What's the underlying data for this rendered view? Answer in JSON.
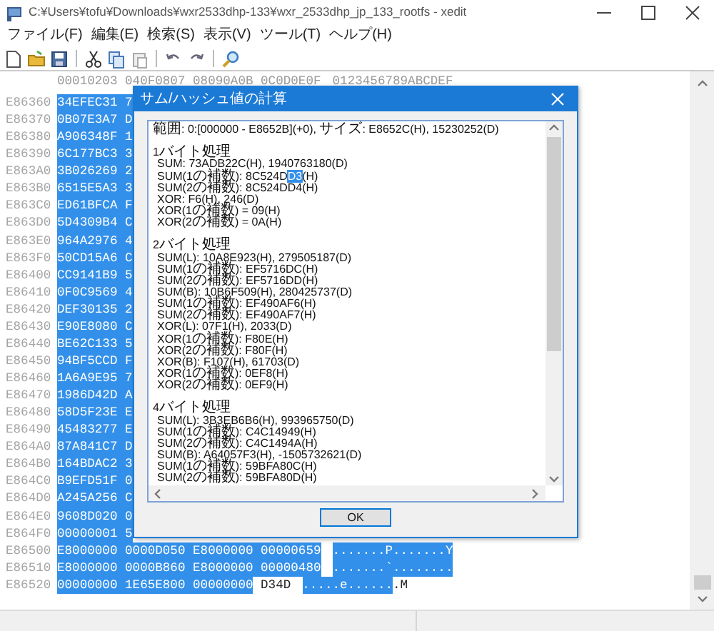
{
  "window": {
    "title": "C:¥Users¥tofu¥Downloads¥wxr2533dhp-133¥wxr_2533dhp_jp_133_rootfs - xedit"
  },
  "menu": [
    "ファイル(F)",
    "編集(E)",
    "検索(S)",
    "表示(V)",
    "ツール(T)",
    "ヘルプ(H)"
  ],
  "hex_view": {
    "header": {
      "hex": "00010203 040F0807 08090A0B 0C0D0E0F",
      "ascii": "0123456789ABCDEF"
    },
    "rows": [
      {
        "address": "E86360",
        "hex": [
          {
            "text": "34EFEC31 7",
            "selected": true
          }
        ]
      },
      {
        "address": "E86370",
        "hex": [
          {
            "text": "0B07E3A7 D",
            "selected": true
          }
        ]
      },
      {
        "address": "E86380",
        "hex": [
          {
            "text": "A906348F 1",
            "selected": true
          }
        ]
      },
      {
        "address": "E86390",
        "hex": [
          {
            "text": "6C177BC3 3",
            "selected": true
          }
        ]
      },
      {
        "address": "E863A0",
        "hex": [
          {
            "text": "3B026269 2",
            "selected": true
          }
        ]
      },
      {
        "address": "E863B0",
        "hex": [
          {
            "text": "6515E5A3 3",
            "selected": true
          }
        ]
      },
      {
        "address": "E863C0",
        "hex": [
          {
            "text": "ED61BFCA F",
            "selected": true
          }
        ]
      },
      {
        "address": "E863D0",
        "hex": [
          {
            "text": "5D4309B4 C",
            "selected": true
          }
        ]
      },
      {
        "address": "E863E0",
        "hex": [
          {
            "text": "964A2976 4",
            "selected": true
          }
        ]
      },
      {
        "address": "E863F0",
        "hex": [
          {
            "text": "50CD15A6 C",
            "selected": true
          }
        ]
      },
      {
        "address": "E86400",
        "hex": [
          {
            "text": "CC9141B9 5",
            "selected": true
          }
        ]
      },
      {
        "address": "E86410",
        "hex": [
          {
            "text": "0F0C9569 4",
            "selected": true
          }
        ]
      },
      {
        "address": "E86420",
        "hex": [
          {
            "text": "DEF30135 2",
            "selected": true
          }
        ]
      },
      {
        "address": "E86430",
        "hex": [
          {
            "text": "E90E8080 C",
            "selected": true
          }
        ]
      },
      {
        "address": "E86440",
        "hex": [
          {
            "text": "BE62C133 5",
            "selected": true
          }
        ]
      },
      {
        "address": "E86450",
        "hex": [
          {
            "text": "94BF5CCD F",
            "selected": true
          }
        ]
      },
      {
        "address": "E86460",
        "hex": [
          {
            "text": "1A6A9E95 7",
            "selected": true
          }
        ]
      },
      {
        "address": "E86470",
        "hex": [
          {
            "text": "1986D42D A",
            "selected": true
          }
        ]
      },
      {
        "address": "E86480",
        "hex": [
          {
            "text": "58D5F23E E",
            "selected": true
          }
        ]
      },
      {
        "address": "E86490",
        "hex": [
          {
            "text": "45483277 E",
            "selected": true
          }
        ]
      },
      {
        "address": "E864A0",
        "hex": [
          {
            "text": "87A841C7 D",
            "selected": true
          }
        ]
      },
      {
        "address": "E864B0",
        "hex": [
          {
            "text": "164BDAC2 3",
            "selected": true
          }
        ]
      },
      {
        "address": "E864C0",
        "hex": [
          {
            "text": "B9EFD51F 0",
            "selected": true
          }
        ]
      },
      {
        "address": "E864D0",
        "hex": [
          {
            "text": "A245A256 C",
            "selected": true
          }
        ]
      },
      {
        "address": "E864E0",
        "hex": [
          {
            "text": "9608D020 0",
            "selected": true
          }
        ]
      },
      {
        "address": "E864F0",
        "hex": [
          {
            "text": "00000001 5",
            "selected": true
          }
        ]
      },
      {
        "address": "E86500",
        "hex": [
          {
            "text": "E8000000 0000D050 E8000000 00000659",
            "selected": true
          }
        ],
        "ascii": [
          {
            "text": ".......P.......Y",
            "selected": true
          }
        ]
      },
      {
        "address": "E86510",
        "hex": [
          {
            "text": "E8000000 0000B860 E8000000 00000480",
            "selected": true
          }
        ],
        "ascii": [
          {
            "text": ".......`........",
            "selected": true
          }
        ]
      },
      {
        "address": "E86520",
        "hex": [
          {
            "text": "00000000 1E65E800 00000000",
            "selected": true
          },
          {
            "text": "D34D",
            "selected": false
          }
        ],
        "ascii": [
          {
            "text": ".....e......",
            "selected": true
          },
          {
            "text": ".M",
            "selected": false
          }
        ]
      }
    ]
  },
  "dialog": {
    "title": "サム/ハッシュ値の計算",
    "summary": "範囲: 0:[000000 - E8652B](+0), サイズ: E8652C(H), 15230252(D)",
    "groups": [
      {
        "heading": "1バイト処理",
        "lines": [
          {
            "text": "SUM: 73ADB22C(H), 1940763180(D)"
          },
          {
            "parts": [
              {
                "text": "SUM(1の補数): 8C524D",
                "selected": false
              },
              {
                "text": "D3",
                "selected": true
              },
              {
                "text": "(H)",
                "selected": false
              }
            ]
          },
          {
            "text": "SUM(2の補数): 8C524DD4(H)"
          },
          {
            "text": "XOR: F6(H), 246(D)"
          },
          {
            "text": "XOR(1の補数) = 09(H)"
          },
          {
            "text": "XOR(2の補数) = 0A(H)"
          }
        ]
      },
      {
        "heading": "2バイト処理",
        "lines": [
          {
            "text": "SUM(L): 10A8E923(H), 279505187(D)"
          },
          {
            "text": "SUM(1の補数): EF5716DC(H)"
          },
          {
            "text": "SUM(2の補数): EF5716DD(H)"
          },
          {
            "text": "SUM(B): 10B6F509(H), 280425737(D)"
          },
          {
            "text": "SUM(1の補数): EF490AF6(H)"
          },
          {
            "text": "SUM(2の補数): EF490AF7(H)"
          },
          {
            "text": "XOR(L): 07F1(H), 2033(D)"
          },
          {
            "text": "XOR(1の補数): F80E(H)"
          },
          {
            "text": "XOR(2の補数): F80F(H)"
          },
          {
            "text": "XOR(B): F107(H), 61703(D)"
          },
          {
            "text": "XOR(1の補数): 0EF8(H)"
          },
          {
            "text": "XOR(2の補数): 0EF9(H)"
          }
        ]
      },
      {
        "heading": "4バイト処理",
        "lines": [
          {
            "text": "SUM(L): 3B3EB6B6(H), 993965750(D)"
          },
          {
            "text": "SUM(1の補数): C4C14949(H)"
          },
          {
            "text": "SUM(2の補数): C4C1494A(H)"
          },
          {
            "text": "SUM(B): A64057F3(H), -1505732621(D)"
          },
          {
            "text": "SUM(1の補数): 59BFA80C(H)"
          },
          {
            "text": "SUM(2の補数): 59BFA80D(H)"
          }
        ]
      }
    ],
    "ok_button": "OK"
  }
}
